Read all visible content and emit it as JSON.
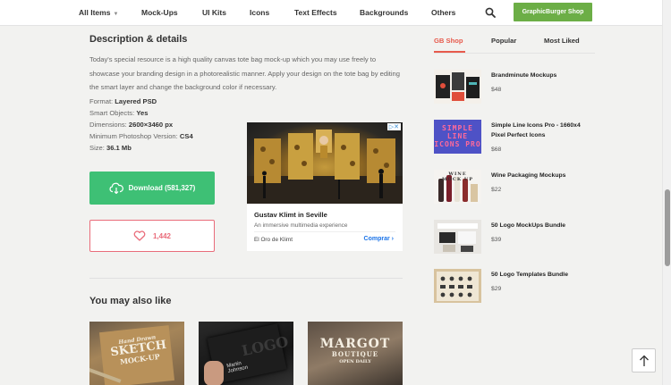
{
  "nav": {
    "items": [
      {
        "label": "All Items",
        "has_caret": true
      },
      {
        "label": "Mock-Ups"
      },
      {
        "label": "UI Kits"
      },
      {
        "label": "Icons"
      },
      {
        "label": "Text Effects"
      },
      {
        "label": "Backgrounds"
      },
      {
        "label": "Others"
      }
    ],
    "caret_glyph": "▼",
    "shop_button": "GraphicBurger Shop"
  },
  "description": {
    "title": "Description & details",
    "text": "Today's special resource is a high quality canvas tote bag mock-up which you may use freely to showcase your branding design in a photorealistic manner. Apply your design on the tote bag by editing the smart layer and change the background color if necessary.",
    "meta": [
      {
        "label": "Format: ",
        "value": "Layered PSD"
      },
      {
        "label": "Smart Objects: ",
        "value": "Yes"
      },
      {
        "label": "Dimensions: ",
        "value": "2600×3460 px"
      },
      {
        "label": "Minimum Photoshop Version: ",
        "value": "CS4"
      },
      {
        "label": "Size: ",
        "value": "36.1 Mb"
      }
    ]
  },
  "download": {
    "label": "Download (581,327)"
  },
  "likes": {
    "count": "1,442"
  },
  "ad": {
    "marker": "▷✕",
    "title": "Gustav Klimt in Seville",
    "subtitle": "An immersive multimedia experience",
    "source": "El Oro de Klimt",
    "cta": "Comprar"
  },
  "related": {
    "title": "You may also like",
    "thumbs": [
      {
        "line1": "Hand Drawn",
        "line2": "SKETCH",
        "line3": "MOCK-UP"
      },
      {
        "line1": "LOGO",
        "line2": "Martin",
        "line3": "Johnson"
      },
      {
        "line1": "MARGOT",
        "line2": "BOUTIQUE",
        "line3": "OPEN DAILY"
      }
    ]
  },
  "sidebar": {
    "tabs": [
      "GB Shop",
      "Popular",
      "Most Liked"
    ],
    "active_tab": "GB Shop",
    "products": [
      {
        "title": "Brandminute Mockups",
        "price": "$48"
      },
      {
        "title": "Simple Line Icons Pro - 1660x4 Pixel Perfect Icons",
        "price": "$68",
        "image_text": "SIMPLE LINE ICONS PRO"
      },
      {
        "title": "Wine Packaging Mockups",
        "price": "$22",
        "image_text": "WINE MOCK UP"
      },
      {
        "title": "50 Logo MockUps Bundle",
        "price": "$39"
      },
      {
        "title": "50 Logo Templates Bundle",
        "price": "$29"
      }
    ]
  },
  "colors": {
    "accent_green": "#6cae46",
    "download_green": "#3ec075",
    "like_red": "#e96c7a",
    "tab_red": "#e75a4c",
    "ad_link": "#1a73e8"
  }
}
